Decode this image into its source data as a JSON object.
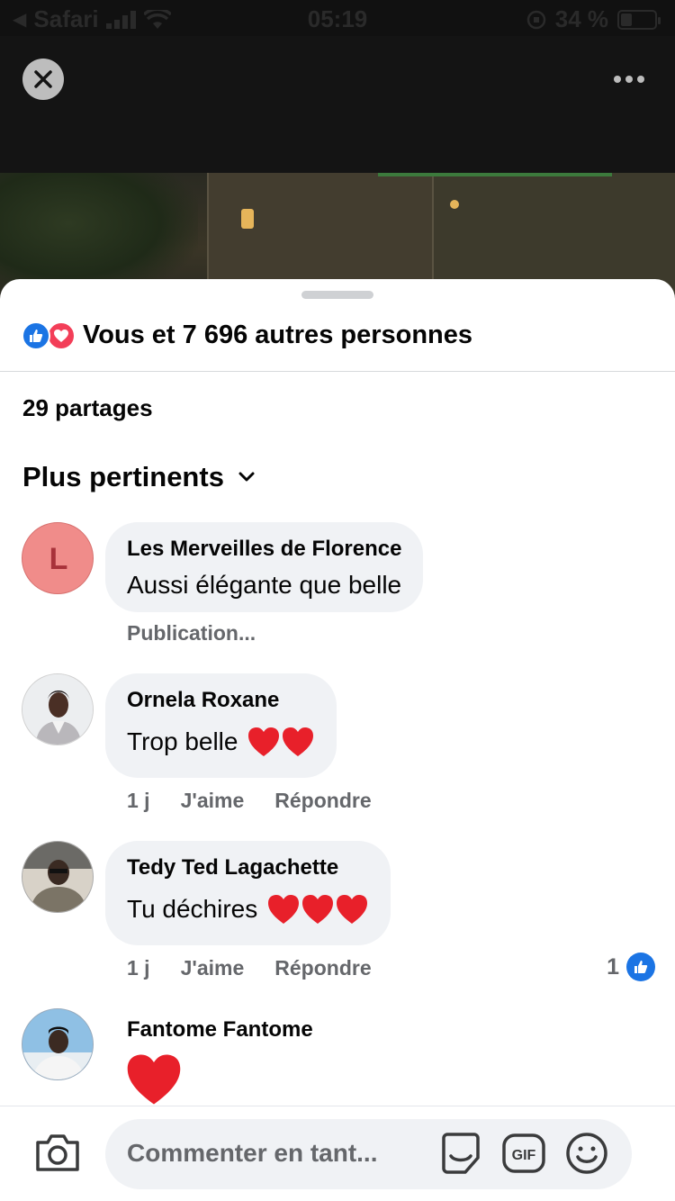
{
  "status_bar": {
    "back_app": "Safari",
    "time": "05:19",
    "battery": "34 %",
    "battery_level": 0.34
  },
  "reactions": {
    "summary": "Vous et 7 696 autres personnes",
    "icons": [
      "like-icon",
      "love-icon"
    ]
  },
  "shares": "29 partages",
  "sort": {
    "label": "Plus pertinents"
  },
  "comments": [
    {
      "author": "Les Merveilles de Florence",
      "avatar_letter": "L",
      "text": "Aussi élégante que belle",
      "meta": "Publication..."
    },
    {
      "author": "Ornela Roxane",
      "text": "Trop belle",
      "hearts": 2,
      "time": "1 j",
      "like": "J'aime",
      "reply": "Répondre"
    },
    {
      "author": "Tedy Ted Lagachette",
      "text": "Tu déchires",
      "hearts": 3,
      "time": "1 j",
      "like": "J'aime",
      "reply": "Répondre",
      "likes": "1"
    },
    {
      "author": "Fantome Fantome",
      "text": "",
      "hearts": 1
    }
  ],
  "composer": {
    "placeholder": "Commenter en tant..."
  },
  "colors": {
    "accent": "#1b74e4",
    "love": "#f33e58",
    "heart": "#e8202a",
    "bubble": "#f0f2f5",
    "muted": "#65676b"
  }
}
